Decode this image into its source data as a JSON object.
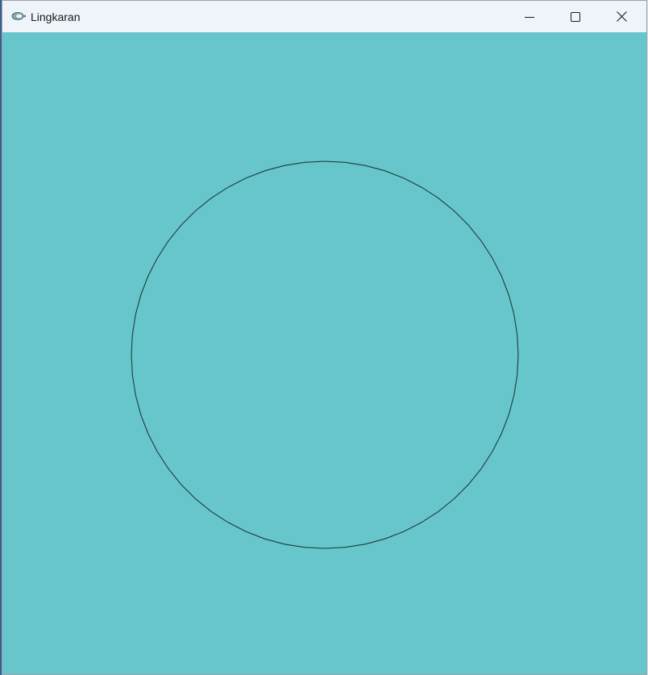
{
  "window": {
    "title": "Lingkaran",
    "app_icon": "opengl-app-icon",
    "controls": {
      "minimize_icon": "minimize-icon",
      "maximize_icon": "maximize-icon",
      "close_icon": "close-icon"
    }
  },
  "canvas": {
    "background_color": "#66c6cc",
    "shape": "circle",
    "stroke_color": "#1f3b3d"
  }
}
